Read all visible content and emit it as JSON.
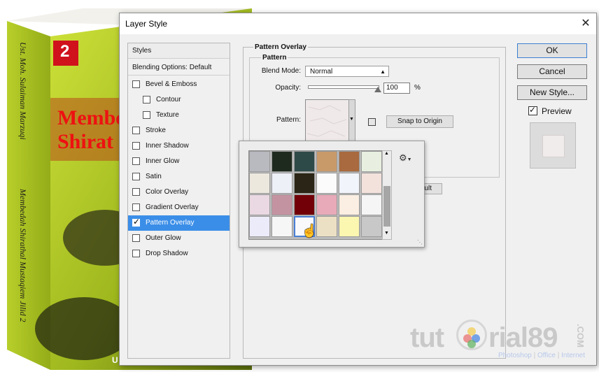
{
  "book": {
    "number": "2",
    "title_line1": "Membe",
    "title_line2": "Shirat",
    "spine_text": "Membedah Shirathal Mustaqiem Jilid 2",
    "author_text": "Ust. Moh. Sulaiman Marzuqi",
    "bottom_text": "U"
  },
  "dialog": {
    "title": "Layer Style",
    "close_glyph": "✕"
  },
  "styles_panel": {
    "header": "Styles",
    "blending": "Blending Options: Default",
    "items": [
      {
        "label": "Bevel & Emboss",
        "checked": false,
        "indent": false,
        "selected": false
      },
      {
        "label": "Contour",
        "checked": false,
        "indent": true,
        "selected": false
      },
      {
        "label": "Texture",
        "checked": false,
        "indent": true,
        "selected": false
      },
      {
        "label": "Stroke",
        "checked": false,
        "indent": false,
        "selected": false
      },
      {
        "label": "Inner Shadow",
        "checked": false,
        "indent": false,
        "selected": false
      },
      {
        "label": "Inner Glow",
        "checked": false,
        "indent": false,
        "selected": false
      },
      {
        "label": "Satin",
        "checked": false,
        "indent": false,
        "selected": false
      },
      {
        "label": "Color Overlay",
        "checked": false,
        "indent": false,
        "selected": false
      },
      {
        "label": "Gradient Overlay",
        "checked": false,
        "indent": false,
        "selected": false
      },
      {
        "label": "Pattern Overlay",
        "checked": true,
        "indent": false,
        "selected": true
      },
      {
        "label": "Outer Glow",
        "checked": false,
        "indent": false,
        "selected": false
      },
      {
        "label": "Drop Shadow",
        "checked": false,
        "indent": false,
        "selected": false
      }
    ]
  },
  "pattern_overlay": {
    "group_title": "Pattern Overlay",
    "subgroup_title": "Pattern",
    "blend_mode_label": "Blend Mode:",
    "blend_mode_value": "Normal",
    "opacity_label": "Opacity:",
    "opacity_value": "100",
    "opacity_unit": "%",
    "opacity_level": 1.0,
    "pattern_label": "Pattern:",
    "snap_button": "Snap to Origin",
    "default_button_partial": "ult"
  },
  "right_buttons": {
    "ok": "OK",
    "cancel": "Cancel",
    "new_style": "New Style...",
    "preview_label": "Preview",
    "preview_checked": true
  },
  "pattern_picker": {
    "gear_icon": "gear-icon",
    "swatches": [
      "#b9b9c0",
      "#1f2a1f",
      "#2e4a48",
      "#c89a6a",
      "#a86a3e",
      "#e8efe0",
      "#ece8de",
      "#eef0f8",
      "#2a2516",
      "#fbfbfb",
      "#f2f4fb",
      "#f3e2dc",
      "#ead8e2",
      "#c493a2",
      "#720008",
      "#e8aab8",
      "#fbeee2",
      "#f5f5f5",
      "#ecebfa",
      "#f6f6f6",
      "#f9f9fb",
      "#ece0c4",
      "#fbf6b0",
      "#c8c8c8"
    ],
    "selected_index": 20
  },
  "watermark": {
    "brand_left": "tut",
    "brand_right": "rial89",
    "dotcom": ".COM",
    "tagline_1": "Photoshop",
    "tagline_2": "Office",
    "tagline_3": "Internet",
    "sep": "|"
  }
}
